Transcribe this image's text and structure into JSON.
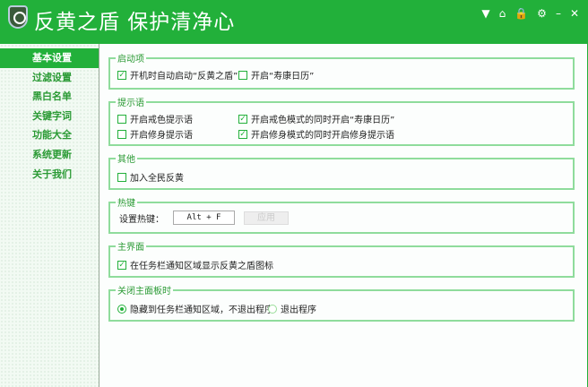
{
  "header": {
    "title": "反黄之盾  保护清净心",
    "controls": [
      "▼",
      "⌂",
      "🔒",
      "⚙",
      "–",
      "✕"
    ]
  },
  "sidebar": {
    "items": [
      "基本设置",
      "过滤设置",
      "黑白名单",
      "关键字词",
      "功能大全",
      "系统更新",
      "关于我们"
    ]
  },
  "groups": {
    "startup": {
      "title": "启动项",
      "opt1": "开机时自动启动“反黄之盾”",
      "opt1_checked": true,
      "opt2": "开启“寿康日历”",
      "opt2_checked": false
    },
    "tips": {
      "title": "提示语",
      "opt1": "开启戒色提示语",
      "opt1_checked": false,
      "opt2": "开启戒色模式的同时开启“寿康日历”",
      "opt2_checked": true,
      "opt3": "开启修身提示语",
      "opt3_checked": false,
      "opt4": "开启修身模式的同时开启修身提示语",
      "opt4_checked": true
    },
    "other": {
      "title": "其他",
      "opt1": "加入全民反黄",
      "opt1_checked": false
    },
    "hotkey": {
      "title": "热键",
      "label": "设置热键：",
      "value": "Alt + F",
      "apply": "应用"
    },
    "main": {
      "title": "主界面",
      "opt1": "在任务栏通知区域显示反黄之盾图标",
      "opt1_checked": true
    },
    "close": {
      "title": "关闭主面板时",
      "opt1": "隐藏到任务栏通知区域，不退出程序",
      "opt2": "退出程序",
      "selected": 1
    }
  }
}
